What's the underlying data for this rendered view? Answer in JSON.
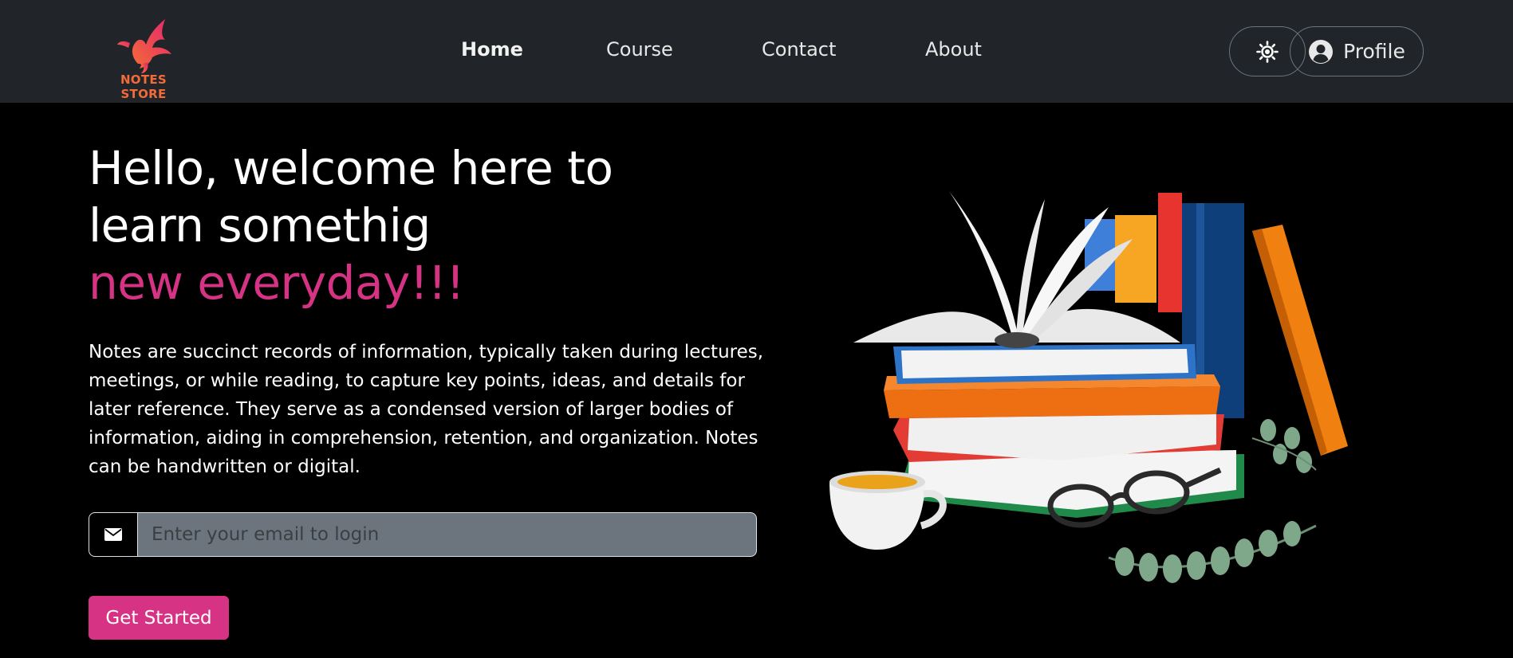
{
  "brand": {
    "name": "NOTES STORE",
    "colors": {
      "primary": "#f26b38",
      "accent": "#e63b6f"
    }
  },
  "nav": {
    "links": [
      {
        "label": "Home",
        "active": true
      },
      {
        "label": "Course"
      },
      {
        "label": "Contact"
      },
      {
        "label": "About"
      }
    ],
    "theme_icon": "sun-icon",
    "profile_label": "Profile",
    "profile_icon": "user-circle-icon"
  },
  "hero": {
    "title_line1": "Hello, welcome here to",
    "title_line2": "learn somethig",
    "title_accent": "new everyday!!!",
    "accent_color": "#d63384",
    "description": "Notes are succinct records of information, typically taken during lectures, meetings, or while reading, to capture key points, ideas, and details for later reference. They serve as a condensed version of larger bodies of information, aiding in comprehension, retention, and organization. Notes can be handwritten or digital.",
    "email": {
      "placeholder": "Enter your email to login",
      "value": "",
      "icon": "envelope-icon"
    },
    "cta_label": "Get Started"
  },
  "illustration": {
    "name": "books-stack-illustration"
  }
}
